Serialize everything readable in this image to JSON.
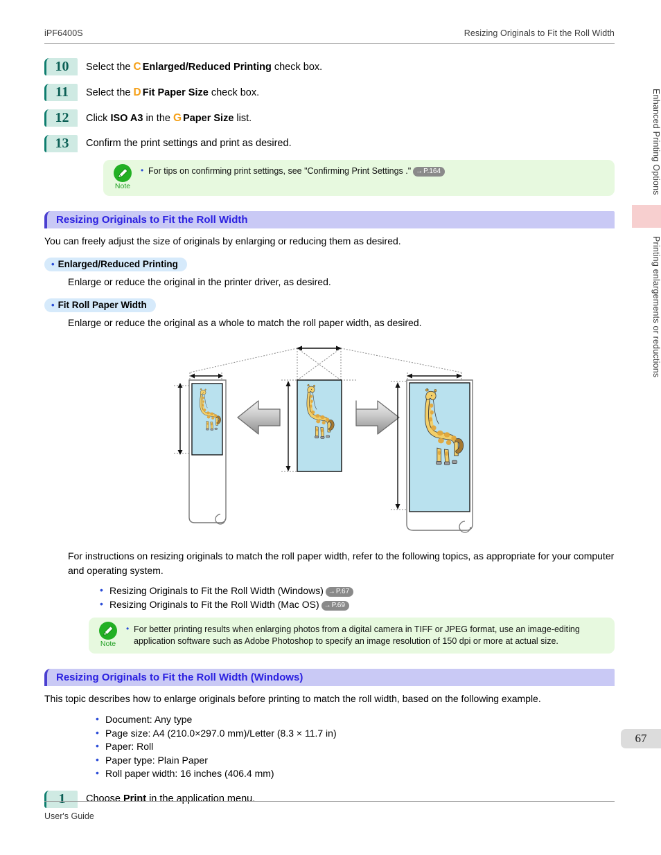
{
  "header": {
    "model": "iPF6400S",
    "topic": "Resizing Originals to Fit the Roll Width"
  },
  "footer": {
    "guide": "User's Guide",
    "page_number": "67"
  },
  "side_tabs": [
    {
      "label": "Enhanced Printing Options"
    },
    {
      "label": "Printing enlargements or reductions"
    }
  ],
  "steps_top": [
    {
      "number": "10",
      "pre": "Select the ",
      "tag": "C",
      "bold": "Enlarged/Reduced Printing",
      "post": " check box."
    },
    {
      "number": "11",
      "pre": "Select the ",
      "tag": "D",
      "bold": "Fit Paper Size",
      "post": " check box."
    },
    {
      "number": "12",
      "pre": "Click ",
      "bold_first": "ISO A3",
      "mid": " in the ",
      "tag": "G",
      "bold": "Paper Size",
      "post": " list."
    },
    {
      "number": "13",
      "pre": "Confirm the print settings and print as desired.",
      "tag": "",
      "bold": "",
      "post": ""
    }
  ],
  "note_1": {
    "icon": "note-pencil-icon",
    "label": "Note",
    "text": "For tips on confirming print settings, see \"Confirming Print Settings .\"",
    "ref": "P.164",
    "ref_arrow": "→"
  },
  "section_1": {
    "heading": "Resizing Originals to Fit the Roll Width",
    "intro": "You can freely adjust the size of originals by enlarging or reducing them as desired.",
    "items": [
      {
        "title": "Enlarged/Reduced Printing",
        "desc": "Enlarge or reduce the original in the printer driver, as desired."
      },
      {
        "title": "Fit Roll Paper Width",
        "desc": "Enlarge or reduce the original as a whole to match the roll paper width, as desired."
      }
    ],
    "after_figure": "For instructions on resizing originals to match the roll paper width, refer to the following topics, as appropriate for your computer and operating system.",
    "links": [
      {
        "label": "Resizing Originals to Fit the Roll Width (Windows)",
        "ref": "P.67"
      },
      {
        "label": "Resizing Originals to Fit the Roll Width (Mac OS)",
        "ref": "P.69"
      }
    ]
  },
  "note_2": {
    "icon": "note-pencil-icon",
    "label": "Note",
    "text": "For better printing results when enlarging photos from a digital camera in TIFF or JPEG format, use an image-editing application software such as Adobe Photoshop to specify an image resolution of 150 dpi or more at actual size."
  },
  "section_2": {
    "heading": "Resizing Originals to Fit the Roll Width (Windows)",
    "intro": "This topic describes how to enlarge originals before printing to match the roll width, based on the following example.",
    "specs": [
      "Document: Any type",
      "Page size: A4 (210.0×297.0 mm)/Letter (8.3 × 11.7 in)",
      "Paper: Roll",
      "Paper type: Plain Paper",
      "Roll paper width: 16 inches (406.4 mm)"
    ],
    "step": {
      "number": "1",
      "pre": "Choose ",
      "bold_first": "Print",
      "post": " in the application menu."
    }
  },
  "figure": {
    "name": "roll-width-resize-diagram",
    "alt": "Three roll-paper panels showing a giraffe original reduced, original size, and enlarged to fit roll width",
    "panels": [
      {
        "name": "reduced-roll-panel"
      },
      {
        "name": "original-panel"
      },
      {
        "name": "enlarged-roll-panel"
      }
    ],
    "arrows": [
      {
        "name": "reduce-arrow-left"
      },
      {
        "name": "enlarge-arrow-right"
      }
    ]
  },
  "colors": {
    "step_badge_bg": "#cfeae3",
    "step_badge_border": "#0e7d6e",
    "step_badge_text": "#0b5f55",
    "tag_letter": "#f5a018",
    "section_bar_bg": "#c9c9f5",
    "section_bar_border": "#4a3fd0",
    "section_bar_text": "#2a1fe0",
    "pill_bg": "#d6eafb",
    "note_bg": "#e7f9df",
    "note_green": "#22b024",
    "ref_chip_bg": "#8a8a8a",
    "side_mark": "#f7cfcf",
    "page_num_bg": "#dcdcdc",
    "giraffe_panel": "#b9e1ee"
  }
}
